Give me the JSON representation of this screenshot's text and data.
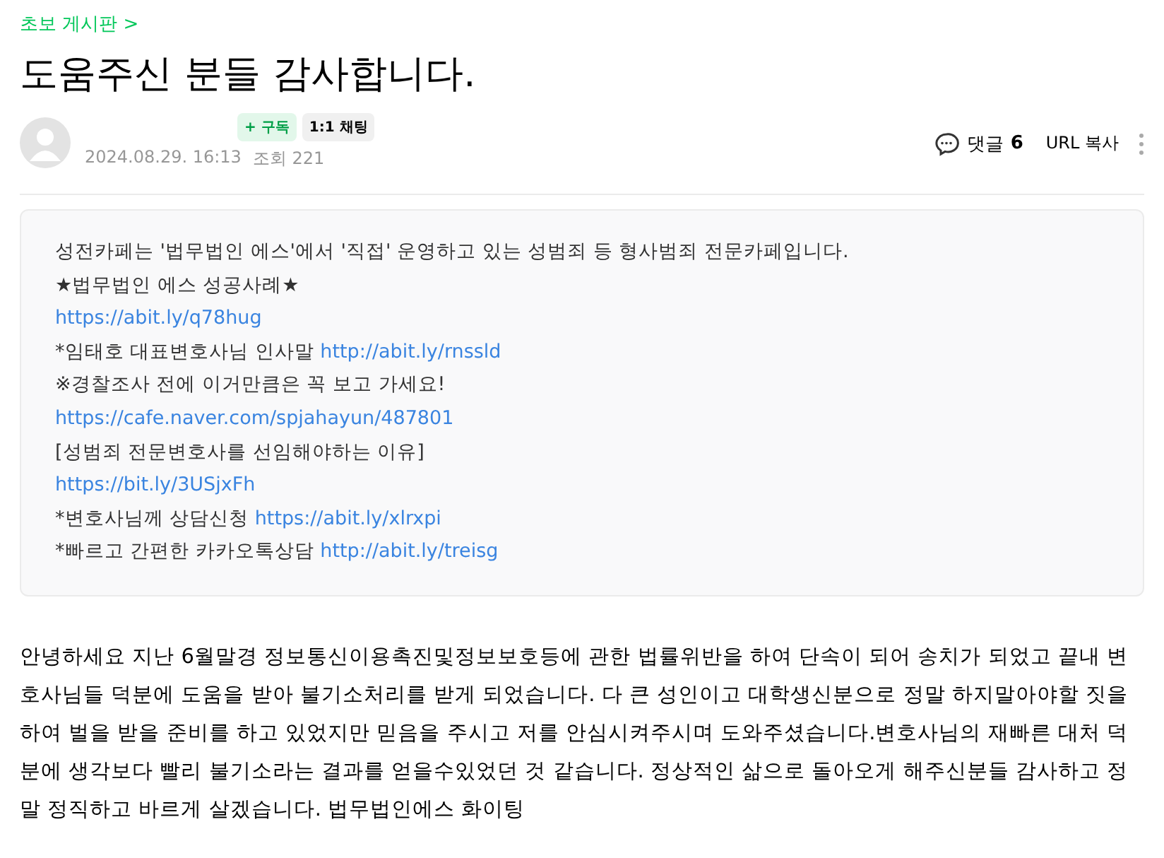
{
  "breadcrumb": "초보 게시판 >",
  "title": "도움주신 분들 감사합니다.",
  "author": {
    "subscribe_button": "+ 구독",
    "chat_button": "1:1 채팅",
    "date": "2024.08.29. 16:13",
    "views": "조회 221"
  },
  "actions": {
    "comments_label": "댓글",
    "comments_count": "6",
    "copy_url": "URL 복사"
  },
  "notice_lines": [
    {
      "text": "성전카페는 '법무법인 에스'에서 '직접' 운영하고 있는 성범죄 등 형사범죄 전문카페입니다."
    },
    {
      "text": "★법무법인 에스 성공사례★"
    },
    {
      "link": "https://abit.ly/q78hug"
    },
    {
      "text": "*임태호 대표변호사님 인사말",
      "link": "http://abit.ly/rnssld"
    },
    {
      "text": "※경찰조사 전에 이거만큼은 꼭 보고 가세요!"
    },
    {
      "link": "https://cafe.naver.com/spjahayun/487801"
    },
    {
      "text": "[성범죄 전문변호사를 선임해야하는 이유]"
    },
    {
      "link": "https://bit.ly/3USjxFh"
    },
    {
      "text": "*변호사님께 상담신청",
      "link": "https://abit.ly/xlrxpi"
    },
    {
      "text": "*빠르고 간편한 카카오톡상담",
      "link": "http://abit.ly/treisg"
    }
  ],
  "body": "안녕하세요 지난 6월말경 정보통신이용촉진및정보보호등에 관한 법률위반을 하여 단속이 되어 송치가 되었고 끝내 변호사님들 덕분에 도움을 받아 불기소처리를 받게 되었습니다. 다 큰 성인이고 대학생신분으로 정말 하지말아야할 짓을 하여 벌을 받을 준비를 하고 있었지만 믿음을 주시고 저를 안심시켜주시며 도와주셨습니다.변호사님의 재빠른 대처 덕분에 생각보다 빨리 불기소라는 결과를 얻을수있었던 것 같습니다. 정상적인 삶으로 돌아오게 해주신분들 감사하고 정말 정직하고 바르게 살겠습니다. 법무법인에스 화이팅"
}
